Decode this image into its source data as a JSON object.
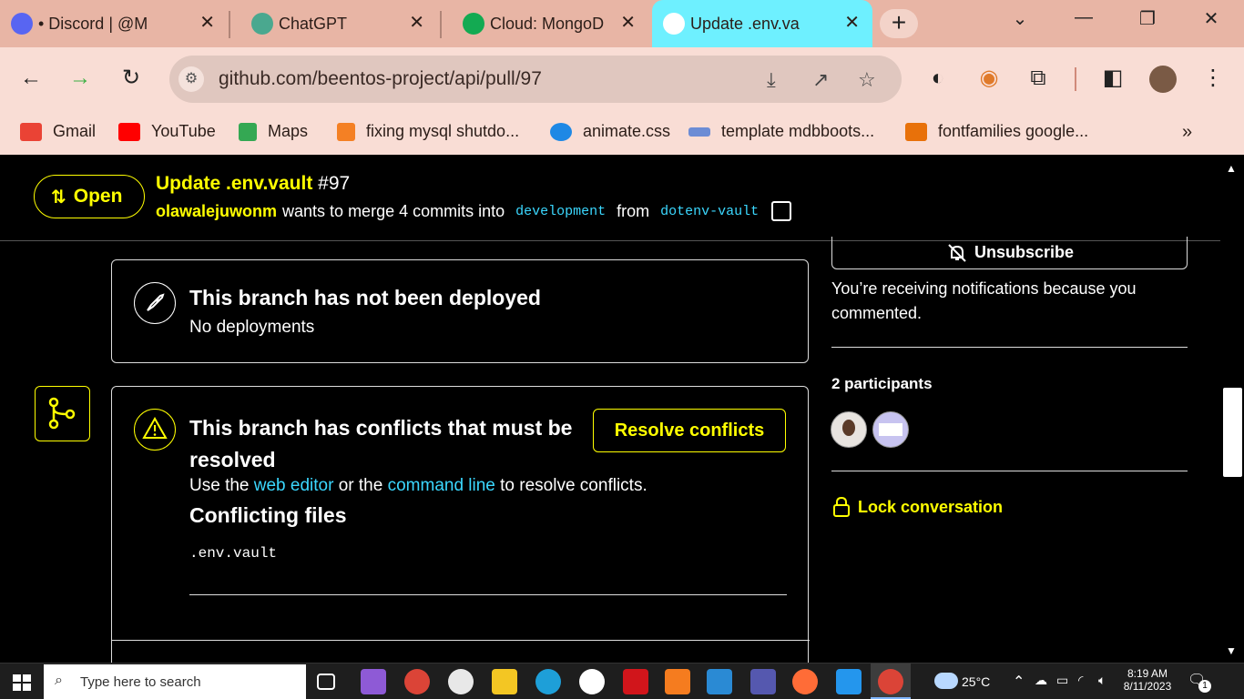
{
  "tabs": [
    {
      "title": "• Discord | @M",
      "icon": "discord-icon"
    },
    {
      "title": "ChatGPT",
      "icon": "chatgpt-icon"
    },
    {
      "title": "Cloud: MongoD",
      "icon": "mongodb-icon"
    },
    {
      "title": "Update .env.va",
      "icon": "github-icon",
      "active": true
    }
  ],
  "tab_close": "✕",
  "new_tab": "+",
  "address_bar": {
    "url": "github.com/beentos-project/api/pull/97"
  },
  "bookmarks": [
    {
      "label": "Gmail",
      "color": "#ea4335"
    },
    {
      "label": "YouTube",
      "color": "#ff0000"
    },
    {
      "label": "Maps",
      "color": "#34a853"
    },
    {
      "label": "fixing mysql shutdo...",
      "color": "#f48024"
    },
    {
      "label": "animate.css",
      "color": "#1e88e5"
    },
    {
      "label": "template mdbboots...",
      "color": "#6c8cd5"
    },
    {
      "label": "fontfamilies google...",
      "color": "#e8710a"
    }
  ],
  "bookmarks_more": "»",
  "pr": {
    "state": "Open",
    "title": "Update .env.vault",
    "number": "#97",
    "author": "olawalejuwonm",
    "merge_text": "wants to merge 4 commits into",
    "base_branch": "development",
    "from_text": "from",
    "head_branch": "dotenv-vault"
  },
  "deploy": {
    "title": "This branch has not been deployed",
    "subtitle": "No deployments"
  },
  "conflicts": {
    "title_line1": "This branch has conflicts that must be",
    "title_line2": "resolved",
    "resolve_button": "Resolve conflicts",
    "text_use": "Use the",
    "link_web_editor": "web editor",
    "text_or": "or the",
    "link_command_line": "command line",
    "text_tail": "to resolve conflicts.",
    "files_heading": "Conflicting files",
    "files": [
      ".env.vault"
    ]
  },
  "sidebar": {
    "unsubscribe": "Unsubscribe",
    "notification_line1": "You’re receiving notifications because you",
    "notification_line2": "commented.",
    "participants": "2 participants",
    "lock": "Lock conversation"
  },
  "taskbar": {
    "search_placeholder": "Type here to search",
    "weather": "25°C",
    "time": "8:19 AM",
    "date": "8/11/2023",
    "notifications": "1"
  },
  "colors": {
    "accent_yellow": "#ffff00",
    "link_cyan": "#3bd8ff",
    "tab_strip": "#e8b5a5",
    "active_tab": "#6ef0ff"
  }
}
